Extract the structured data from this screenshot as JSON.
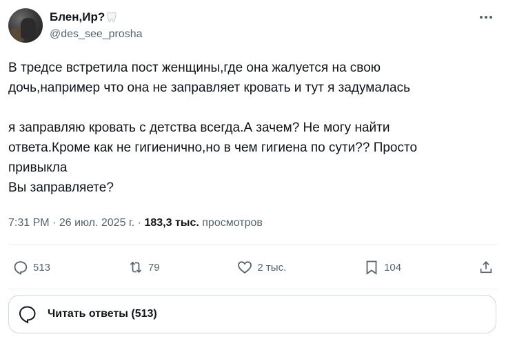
{
  "author": {
    "display_name": "Блен,Ир?",
    "handle": "@des_see_prosha",
    "name_emoji": "tooth-icon"
  },
  "tweet": {
    "text": "В тредсе встретила пост женщины,где она жалуется на свою\nдочь,например что она не заправляет кровать и тут я задумалась\n\nя заправляю кровать с детства всегда.А зачем? Не могу найти\nответа.Кроме как не гигиенично,но в чем гигиена по сути?? Просто\nпривыкла\nВы заправляете?",
    "time": "7:31 PM",
    "sep1": "·",
    "date": "26 июл. 2025 г.",
    "sep2": "·",
    "views_count": "183,3 тыс.",
    "views_label": "просмотров"
  },
  "actions": {
    "replies": "513",
    "retweets": "79",
    "likes": "2 тыс.",
    "bookmarks": "104"
  },
  "read_replies": {
    "label": "Читать ответы (513)"
  },
  "icons": {
    "more": "more-horizontal-icon",
    "reply": "reply-bubble-icon",
    "retweet": "retweet-icon",
    "like": "heart-icon",
    "bookmark": "bookmark-icon",
    "share": "share-icon"
  },
  "colors": {
    "text": "#0f1419",
    "secondary": "#536471",
    "border": "#cfd9de",
    "divider": "#eff3f4"
  }
}
